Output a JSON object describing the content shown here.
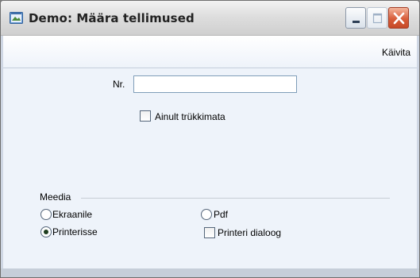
{
  "window": {
    "title": "Demo: Määra tellimused",
    "app_icon": "app-window-icon",
    "controls": [
      "minimize-icon",
      "maximize-icon",
      "close-icon"
    ],
    "accent": "#d85d3a"
  },
  "toolbar": {
    "run_label": "Käivita"
  },
  "form": {
    "nr_label": "Nr.",
    "nr_value": "",
    "unprinted_only_label": "Ainult trükkimata",
    "unprinted_only_checked": false
  },
  "media": {
    "group_label": "Meedia",
    "options": [
      {
        "label": "Ekraanile",
        "selected": false
      },
      {
        "label": "Printerisse",
        "selected": true
      },
      {
        "label": "Pdf",
        "selected": false
      }
    ],
    "printer_dialog_label": "Printeri dialoog",
    "printer_dialog_checked": false
  }
}
